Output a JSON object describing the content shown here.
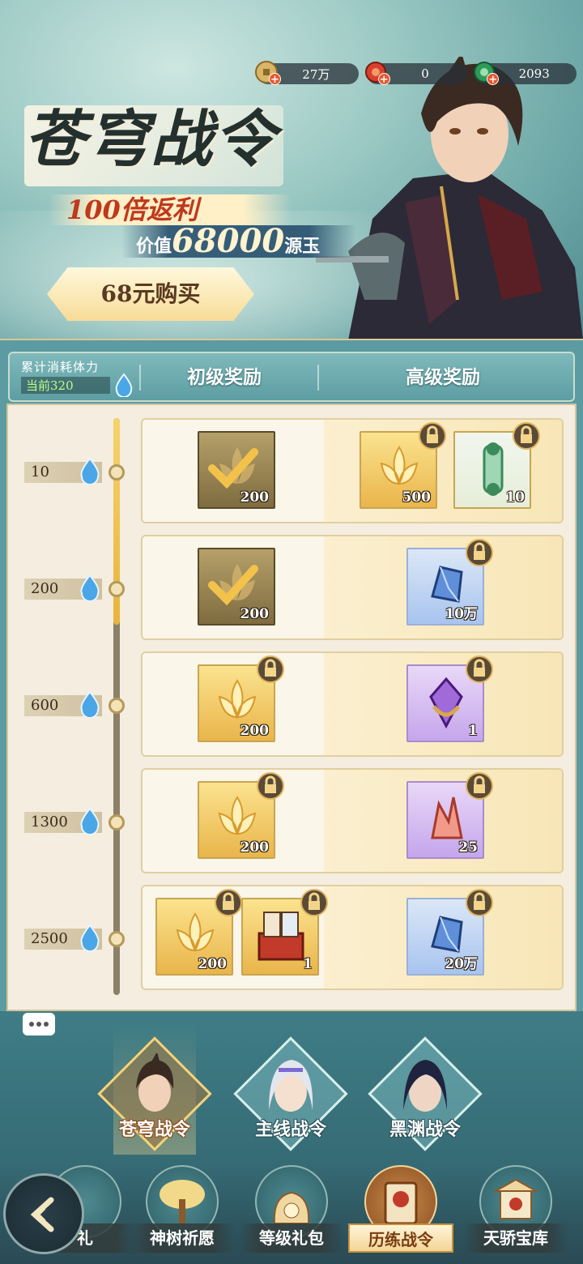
{
  "currencies": [
    {
      "icon": "coin-icon",
      "value": "27万"
    },
    {
      "icon": "red-gem-icon",
      "value": "0"
    },
    {
      "icon": "green-jade-icon",
      "value": "2093"
    }
  ],
  "banner": {
    "title": "苍穹战令",
    "rebate": "100倍返利",
    "value_prefix": "价值",
    "value_amount": "68000",
    "value_suffix": "源玉",
    "buy_label": "68元购买"
  },
  "header": {
    "stamina_label": "累计消耗体力",
    "stamina_current": "当前320",
    "basic_tab": "初级奖励",
    "advanced_tab": "高级奖励"
  },
  "rows": [
    {
      "level": "10",
      "basic": [
        {
          "type": "lotus",
          "qty": "200",
          "state": "claimed"
        }
      ],
      "advanced": [
        {
          "type": "lotus",
          "qty": "500",
          "state": "locked"
        },
        {
          "type": "scroll",
          "qty": "10",
          "state": "locked"
        }
      ]
    },
    {
      "level": "200",
      "basic": [
        {
          "type": "lotus",
          "qty": "200",
          "state": "claimed"
        }
      ],
      "advanced": [
        {
          "type": "blue-crystal",
          "qty": "10万",
          "state": "locked"
        }
      ]
    },
    {
      "level": "600",
      "basic": [
        {
          "type": "lotus",
          "qty": "200",
          "state": "locked"
        }
      ],
      "advanced": [
        {
          "type": "purple-gem",
          "qty": "1",
          "state": "locked"
        }
      ]
    },
    {
      "level": "1300",
      "basic": [
        {
          "type": "lotus",
          "qty": "200",
          "state": "locked"
        }
      ],
      "advanced": [
        {
          "type": "pink-crystal",
          "qty": "25",
          "state": "locked"
        }
      ]
    },
    {
      "level": "2500",
      "basic": [
        {
          "type": "lotus",
          "qty": "200",
          "state": "locked"
        },
        {
          "type": "card-box",
          "qty": "1",
          "state": "locked"
        }
      ],
      "advanced": [
        {
          "type": "blue-crystal",
          "qty": "20万",
          "state": "locked"
        }
      ]
    }
  ],
  "pass_tabs": [
    {
      "label": "苍穹战令",
      "active": true
    },
    {
      "label": "主线战令",
      "active": false
    },
    {
      "label": "黑渊战令",
      "active": false
    }
  ],
  "bottom_nav": [
    {
      "label": "礼",
      "icon": "gift-icon",
      "active": false
    },
    {
      "label": "神树祈愿",
      "icon": "tree-icon",
      "active": false
    },
    {
      "label": "等级礼包",
      "icon": "bag-icon",
      "active": false
    },
    {
      "label": "历练战令",
      "icon": "token-icon",
      "active": true
    },
    {
      "label": "天骄宝库",
      "icon": "treasury-icon",
      "active": false
    }
  ],
  "colors": {
    "accent_gold": "#f5d27a",
    "teal_bg": "#5b9ba1",
    "lock_gold": "#e0b45a"
  }
}
